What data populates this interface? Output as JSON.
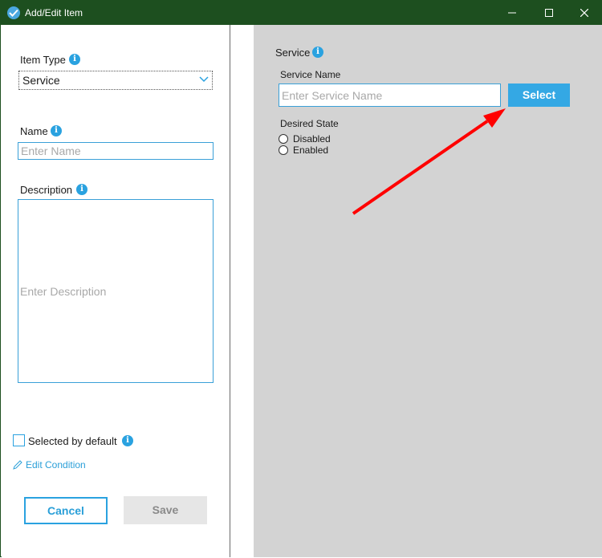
{
  "window": {
    "title": "Add/Edit Item"
  },
  "left": {
    "item_type_label": "Item Type",
    "item_type_value": "Service",
    "name_label": "Name",
    "name_placeholder": "Enter Name",
    "description_label": "Description",
    "description_placeholder": "Enter Description",
    "selected_by_default_label": "Selected by default",
    "edit_condition_label": "Edit Condition",
    "cancel_label": "Cancel",
    "save_label": "Save"
  },
  "right": {
    "section_title": "Service",
    "service_name_label": "Service Name",
    "service_name_placeholder": "Enter Service Name",
    "select_label": "Select",
    "desired_state_label": "Desired State",
    "options": [
      "Disabled",
      "Enabled"
    ]
  },
  "colors": {
    "titlebar": "#1d4f1f",
    "accent": "#2aa2e0",
    "panel_gray": "#d3d3d3",
    "annotation_arrow": "#ff0000"
  },
  "icons": [
    "check-circle-icon",
    "minimize-icon",
    "maximize-icon",
    "close-icon",
    "info-icon",
    "chevron-down-icon",
    "pencil-icon",
    "arrow-annotation"
  ]
}
